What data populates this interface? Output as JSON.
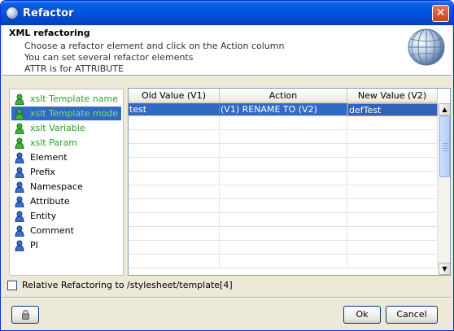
{
  "window": {
    "title": "Refactor",
    "close_symbol": "✕"
  },
  "header": {
    "title": "XML refactoring",
    "lines": [
      "Choose a refactor element and click on the Action column",
      "You can set several refactor elements",
      "ATTR is for ATTRIBUTE"
    ],
    "icon": "globe-icon"
  },
  "element_list": {
    "items": [
      {
        "label": "xslt Template name",
        "icon": "person-green-icon",
        "color": "#2da12d"
      },
      {
        "label": "xslt Template mode",
        "icon": "person-green-icon",
        "color": "#7fe05f",
        "selected": true
      },
      {
        "label": "xslt Variable",
        "icon": "person-green-icon",
        "color": "#2da12d"
      },
      {
        "label": "xslt Param",
        "icon": "person-green-icon",
        "color": "#2da12d"
      },
      {
        "label": "Element",
        "icon": "person-blue-icon",
        "color": "#000000"
      },
      {
        "label": "Prefix",
        "icon": "person-blue-icon",
        "color": "#000000"
      },
      {
        "label": "Namespace",
        "icon": "person-blue-icon",
        "color": "#000000"
      },
      {
        "label": "Attribute",
        "icon": "person-blue-icon",
        "color": "#000000"
      },
      {
        "label": "Entity",
        "icon": "person-blue-icon",
        "color": "#000000"
      },
      {
        "label": "Comment",
        "icon": "person-blue-icon",
        "color": "#000000"
      },
      {
        "label": "PI",
        "icon": "person-blue-icon",
        "color": "#000000"
      }
    ]
  },
  "table": {
    "columns": [
      "Old Value (V1)",
      "Action",
      "New Value (V2)"
    ],
    "rows": [
      {
        "old": "test",
        "action": "(V1) RENAME TO (V2)",
        "new": "defTest",
        "selected": true
      }
    ],
    "scroll_up": "▲",
    "scroll_down": "▼"
  },
  "relative_checkbox": {
    "label": "Relative Refactoring to /stylesheet/template[4]",
    "checked": false
  },
  "buttons": {
    "ok": "Ok",
    "cancel": "Cancel",
    "lock_icon": "lock-icon"
  },
  "colors": {
    "selection": "#316ac5",
    "titlebar": "#0055e5",
    "green_label": "#2da12d"
  }
}
